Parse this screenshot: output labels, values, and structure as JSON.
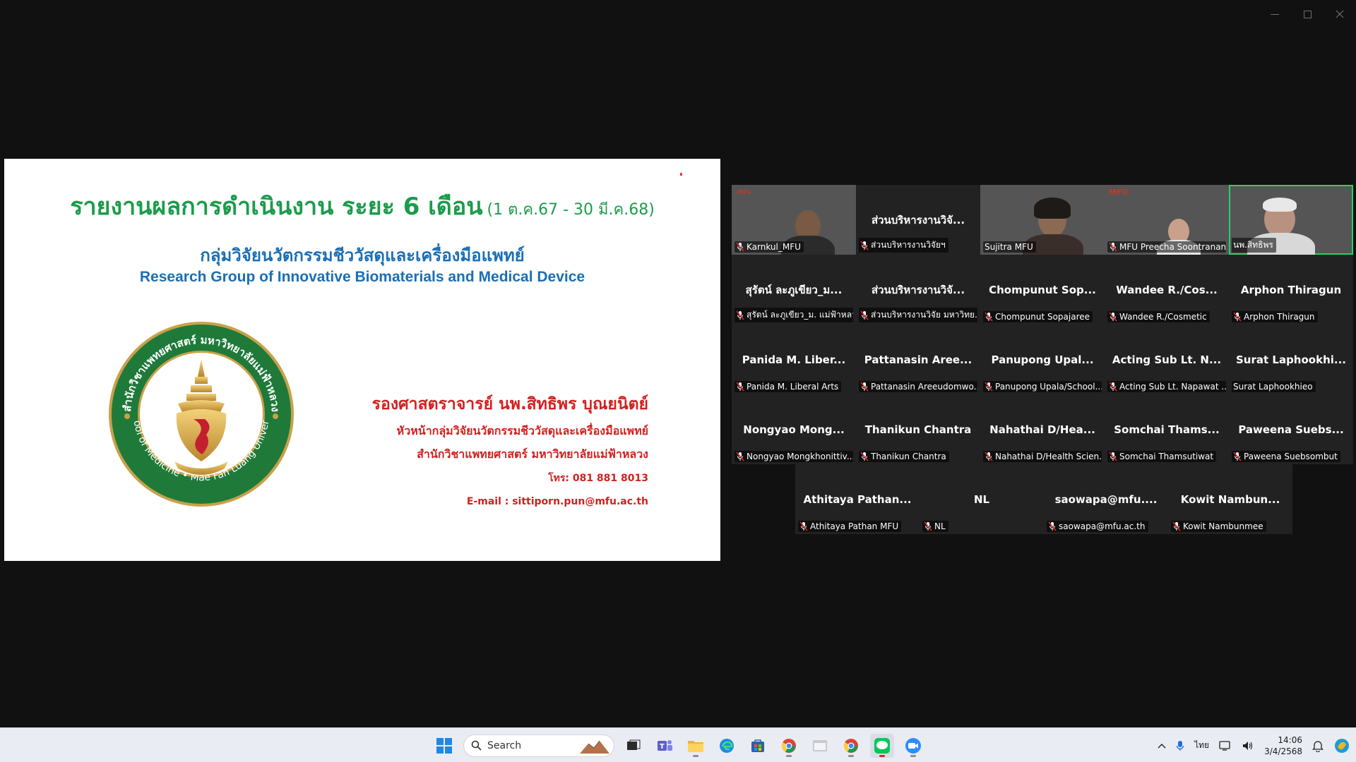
{
  "slide": {
    "title": "รายงานผลการดำเนินงาน ระยะ 6 เดือน",
    "title_period": "(1 ต.ค.67 - 30 มี.ค.68)",
    "group_th": "กลุ่มวิจัยนวัตกรรมชีววัสดุและเครื่องมือแพทย์",
    "group_en": "Research Group of Innovative Biomaterials and Medical Device",
    "logo": {
      "outer_text": "สำนักวิชาแพทยศาสตร์ มหาวิทยาลัยแม่ฟ้าหลวง",
      "inner_text": "School of Medicine • Mae Fah Luang University"
    },
    "presenter_name": "รองศาสตราจารย์ นพ.สิทธิพร บุณยนิตย์",
    "presenter_role": "หัวหน้ากลุ่มวิจัยนวัตกรรมชีววัสดุและเครื่องมือแพทย์",
    "presenter_inst": "สำนักวิชาแพทยศาสตร์ มหาวิทยาลัยแม่ฟ้าหลวง",
    "presenter_tel": "โทร: 081 881 8013",
    "presenter_email": "E-mail : sittiporn.pun@mfu.ac.th"
  },
  "participants": [
    {
      "big": "",
      "tag": "Karnkul_MFU",
      "video": true
    },
    {
      "big": "ส่วนบริหารงานวิจั...",
      "tag": "ส่วนบริหารงานวิจัยฯ",
      "video": false
    },
    {
      "big": "",
      "tag": "Sujitra MFU",
      "video": true
    },
    {
      "big": "",
      "tag": "MFU Preecha Soontranan",
      "video": true
    },
    {
      "big": "",
      "tag": "นพ.สิทธิพร",
      "video": true
    },
    {
      "big": "สุรัตน์ ละภูเขียว_ม...",
      "tag": "สุรัตน์ ละภูเขียว_ม. แม่ฟ้าหลวง",
      "video": false
    },
    {
      "big": "ส่วนบริหารงานวิจั...",
      "tag": "ส่วนบริหารงานวิจัย มหาวิทย...",
      "video": false
    },
    {
      "big": "Chompunut Sop...",
      "tag": "Chompunut Sopajaree",
      "video": false
    },
    {
      "big": "Wandee R./Cos...",
      "tag": "Wandee R./Cosmetic",
      "video": false
    },
    {
      "big": "Arphon Thiragun",
      "tag": "Arphon Thiragun",
      "video": false
    },
    {
      "big": "Panida M. Liber...",
      "tag": "Panida M. Liberal Arts",
      "video": false
    },
    {
      "big": "Pattanasin Aree...",
      "tag": "Pattanasin Areeudomwo...",
      "video": false
    },
    {
      "big": "Panupong Upal...",
      "tag": "Panupong Upala/School...",
      "video": false
    },
    {
      "big": "Acting Sub Lt. N...",
      "tag": "Acting Sub Lt. Napawat ...",
      "video": false
    },
    {
      "big": "Surat Laphookhi...",
      "tag": "Surat Laphookhieo",
      "video": false
    },
    {
      "big": "Nongyao Mong...",
      "tag": "Nongyao Mongkhonittiv...",
      "video": false
    },
    {
      "big": "Thanikun Chantra",
      "tag": "Thanikun Chantra",
      "video": false
    },
    {
      "big": "Nahathai D/Hea...",
      "tag": "Nahathai D/Health Scien...",
      "video": false
    },
    {
      "big": "Somchai Thams...",
      "tag": "Somchai Thamsutiwat",
      "video": false
    },
    {
      "big": "Paweena Suebs...",
      "tag": "Paweena Suebsombut",
      "video": false
    },
    {
      "big": "Athitaya Pathan...",
      "tag": "Athitaya Pathan MFU",
      "video": false
    },
    {
      "big": "NL",
      "tag": "NL",
      "video": false
    },
    {
      "big": "saowapa@mfu....",
      "tag": "saowapa@mfu.ac.th",
      "video": false
    },
    {
      "big": "Kowit Nambun...",
      "tag": "Kowit Nambunmee",
      "video": false
    }
  ],
  "video_overlays": {
    "karnkul_brand": "MFU",
    "preecha_brand": "MFU"
  },
  "taskbar": {
    "search_placeholder": "Search",
    "lang": "ไทย",
    "time": "14:06",
    "date": "3/4/2568"
  }
}
